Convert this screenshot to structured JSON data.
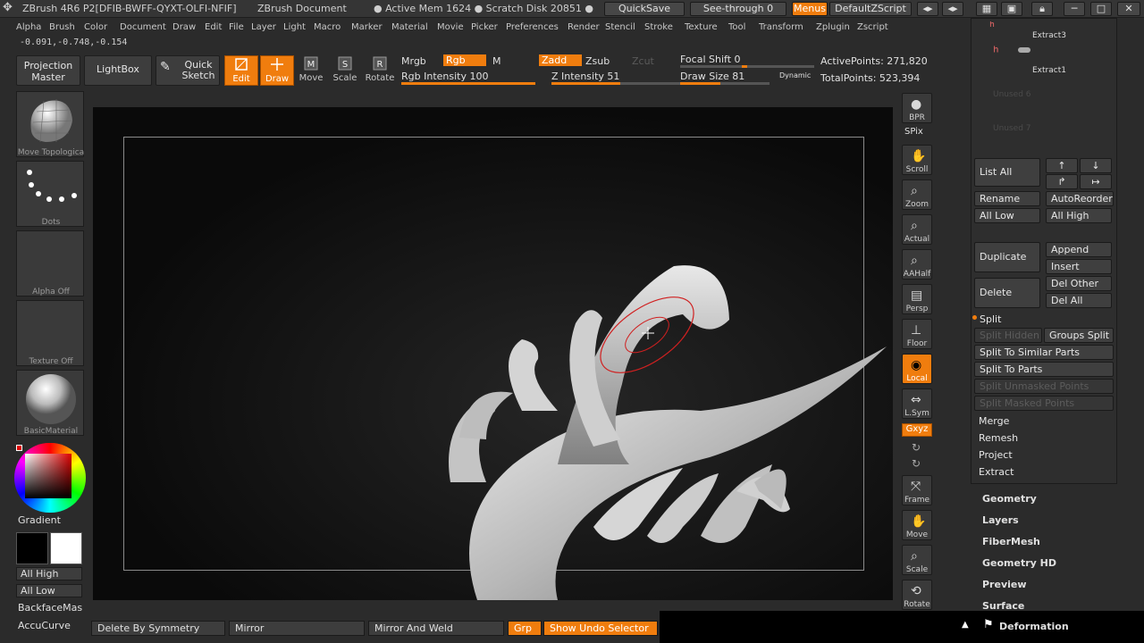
{
  "titlebar": {
    "title": "ZBrush 4R6 P2[DFIB-BWFF-QYXT-OLFI-NFIF]",
    "document": "ZBrush Document",
    "mem": "● Active Mem 1624 ● Scratch Disk 20851 ●",
    "quicksave": "QuickSave",
    "seethrough": "See-through  0",
    "menus": "Menus",
    "script": "DefaultZScript"
  },
  "menubar": [
    "Alpha",
    "Brush",
    "Color",
    "Document",
    "Draw",
    "Edit",
    "File",
    "Layer",
    "Light",
    "Macro",
    "Marker",
    "Material",
    "Movie",
    "Picker",
    "Preferences",
    "Render",
    "Stencil",
    "Stroke",
    "Texture",
    "Tool",
    "Transform",
    "Zplugin",
    "Zscript"
  ],
  "coords": "-0.091,-0.748,-0.154",
  "toolbar": {
    "projection_master": "Projection Master",
    "lightbox": "LightBox",
    "quick_sketch": "Quick Sketch",
    "edit": "Edit",
    "draw": "Draw",
    "move": "Move",
    "scale": "Scale",
    "rotate": "Rotate",
    "mrgb": "Mrgb",
    "rgb": "Rgb",
    "m": "M",
    "zadd": "Zadd",
    "zsub": "Zsub",
    "zcut": "Zcut",
    "rgb_intensity": "Rgb Intensity 100",
    "z_intensity": "Z Intensity 51",
    "focal_shift": "Focal Shift 0",
    "draw_size": "Draw Size 81",
    "dynamic": "Dynamic",
    "active_points": "ActivePoints: 271,820",
    "total_points": "TotalPoints: 523,394",
    "rgb_intensity_value": 100,
    "z_intensity_value": 51,
    "focal_shift_value": 0,
    "draw_size_value": 81
  },
  "left_shelf": {
    "brush_label": "Move Topologica",
    "stroke_label": "Dots",
    "alpha_label": "Alpha  Off",
    "texture_label": "Texture  Off",
    "material_label": "BasicMaterial",
    "gradient": "Gradient",
    "all_high": "All High",
    "all_low": "All Low",
    "backface": "BackfaceMas",
    "accucurve": "AccuCurve"
  },
  "right_shelf": {
    "bpr": "BPR",
    "spix": "SPix",
    "scroll": "Scroll",
    "zoom": "Zoom",
    "actual": "Actual",
    "aahalf": "AAHalf",
    "persp": "Persp",
    "floor": "Floor",
    "local": "Local",
    "lsym": "L.Sym",
    "xyz": "Gxyz",
    "frame": "Frame",
    "move": "Move",
    "scale": "Scale",
    "rotate": "Rotate"
  },
  "subtool_panel": {
    "extract3": "Extract3",
    "extract1": "Extract1",
    "unused6": "Unused  6",
    "unused7": "Unused  7",
    "list_all": "List  All",
    "rename": "Rename",
    "autoreorder": "AutoReorder",
    "all_low": "All Low",
    "all_high": "All High",
    "duplicate": "Duplicate",
    "append": "Append",
    "insert": "Insert",
    "delete": "Delete",
    "del_other": "Del Other",
    "del_all": "Del All",
    "split": "Split",
    "split_hidden": "Split Hidden",
    "groups_split": "Groups Split",
    "split_similar": "Split To Similar Parts",
    "split_parts": "Split To Parts",
    "split_unmasked": "Split Unmasked Points",
    "split_masked": "Split Masked Points",
    "merge": "Merge",
    "remesh": "Remesh",
    "project": "Project",
    "extract": "Extract"
  },
  "tool_sections": [
    "Geometry",
    "Layers",
    "FiberMesh",
    "Geometry HD",
    "Preview",
    "Surface",
    "Deformation"
  ],
  "bottom": {
    "delete_by_symmetry": "Delete By Symmetry",
    "mirror": "Mirror",
    "mirror_weld": "Mirror And Weld",
    "grp": "Grp",
    "show_undo": "Show Undo Selector"
  },
  "colors": {
    "accent": "#f07d0e",
    "bg": "#2b2b2b",
    "canvas": "#0e0e0e"
  }
}
